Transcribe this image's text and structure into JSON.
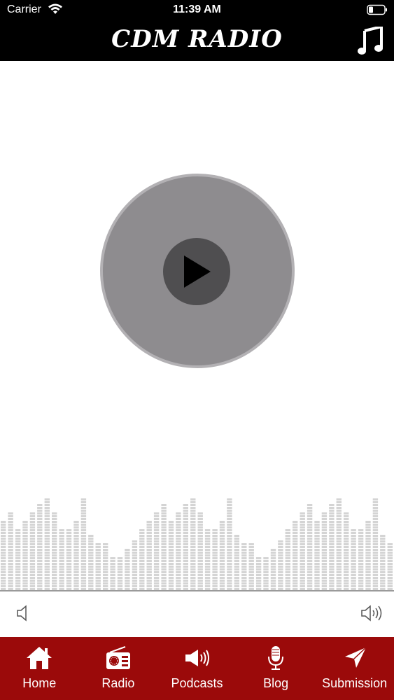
{
  "status": {
    "carrier": "Carrier",
    "time": "11:39 AM"
  },
  "header": {
    "title": "CDM RADIO",
    "music_icon": "music-note-icon"
  },
  "player": {
    "state": "paused",
    "play_icon": "play-icon"
  },
  "equalizer": {
    "levels": [
      0.72,
      0.81,
      0.64,
      0.72,
      0.81,
      0.89,
      0.94,
      0.81,
      0.64,
      0.64,
      0.72,
      0.94,
      0.56,
      0.47,
      0.47,
      0.33,
      0.33,
      0.42,
      0.5,
      0.64,
      0.72,
      0.81,
      0.89,
      0.72,
      0.81,
      0.89,
      0.94,
      0.81,
      0.64,
      0.64,
      0.72,
      0.94,
      0.56,
      0.47,
      0.47,
      0.33,
      0.33,
      0.42,
      0.5,
      0.64,
      0.72,
      0.81,
      0.89,
      0.72,
      0.81,
      0.89,
      0.94,
      0.81,
      0.64,
      0.64,
      0.72,
      0.94,
      0.56,
      0.47
    ],
    "color": "#d4d4d4"
  },
  "volume": {
    "low_icon": "volume-low-icon",
    "high_icon": "volume-high-icon"
  },
  "colors": {
    "header_bg": "#000000",
    "tabbar_bg": "#9b0a0a",
    "disc": "#8e8c8f",
    "play_bg": "#4f4e50"
  },
  "tabs": [
    {
      "label": "Home",
      "icon": "home-icon"
    },
    {
      "label": "Radio",
      "icon": "radio-icon"
    },
    {
      "label": "Podcasts",
      "icon": "megaphone-icon"
    },
    {
      "label": "Blog",
      "icon": "microphone-icon"
    },
    {
      "label": "Submission",
      "icon": "send-icon"
    }
  ]
}
